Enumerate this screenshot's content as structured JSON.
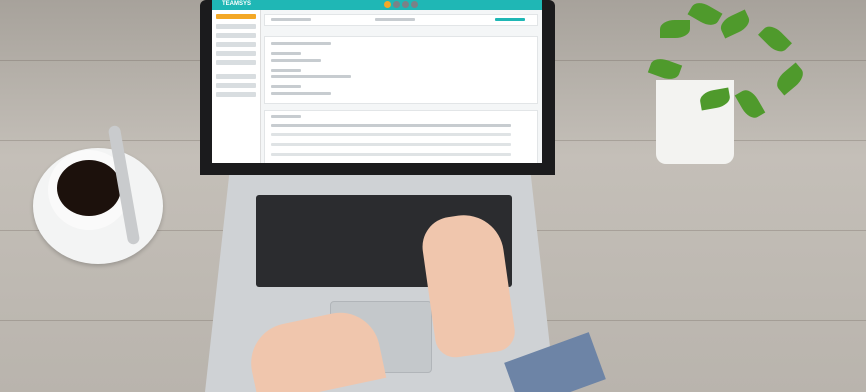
{
  "scene": {
    "description_items": [
      "laptop",
      "hands",
      "coffee-cup",
      "spoon",
      "saucer",
      "potted-plant",
      "wooden-desk"
    ],
    "screen": {
      "brand": "TEAMSYS"
    }
  }
}
